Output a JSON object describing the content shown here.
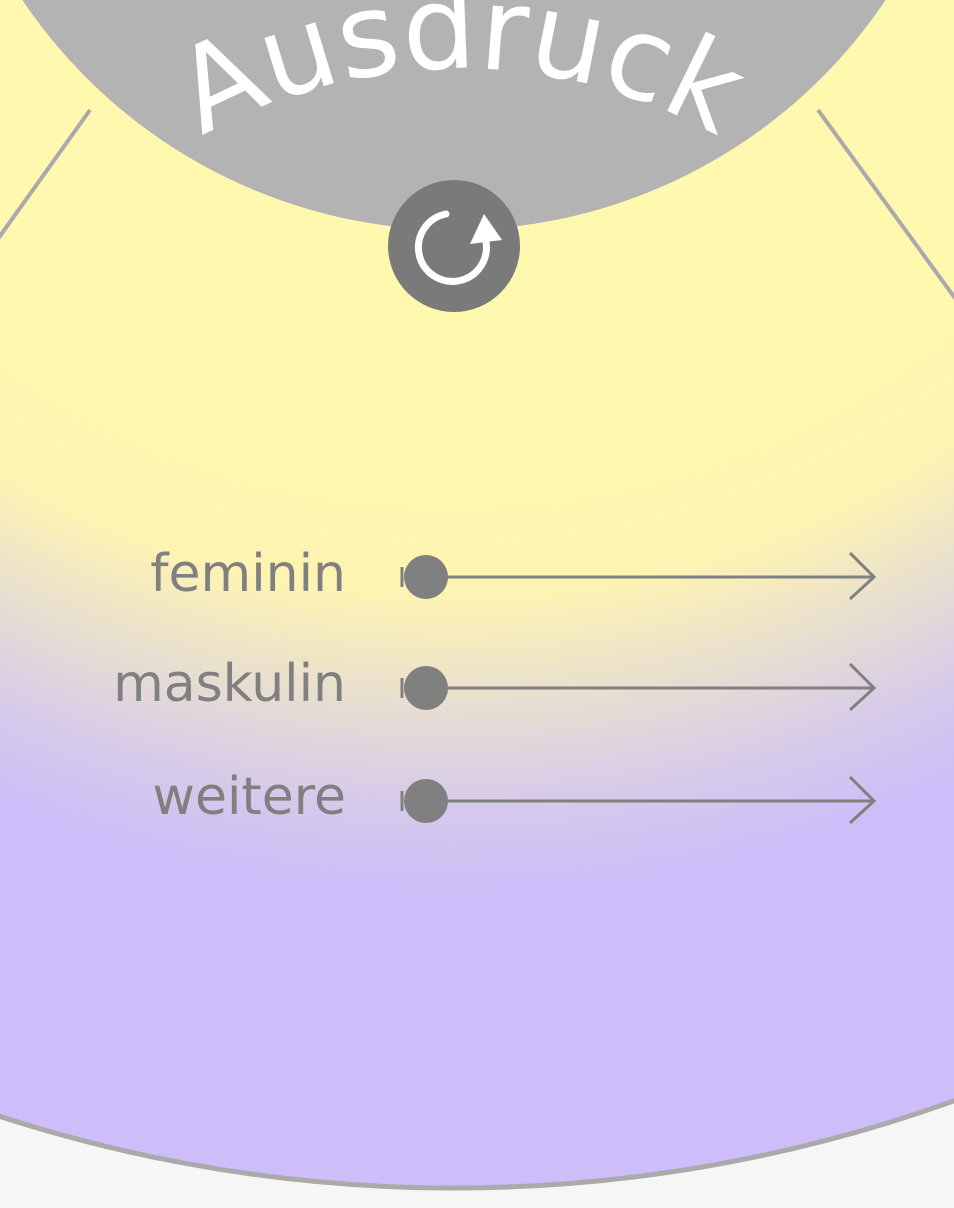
{
  "wheel": {
    "segment_title": "Ausdruck",
    "colors": {
      "top": "#fff8ae",
      "bottom": "#cdbdf8",
      "center": "#b3b3b3",
      "divider": "#aaaaaa",
      "control": "#808080"
    }
  },
  "reset": {
    "icon": "rotate-clockwise-icon"
  },
  "sliders": [
    {
      "label": "feminin",
      "value": 0
    },
    {
      "label": "maskulin",
      "value": 0
    },
    {
      "label": "weitere",
      "value": 0
    }
  ]
}
